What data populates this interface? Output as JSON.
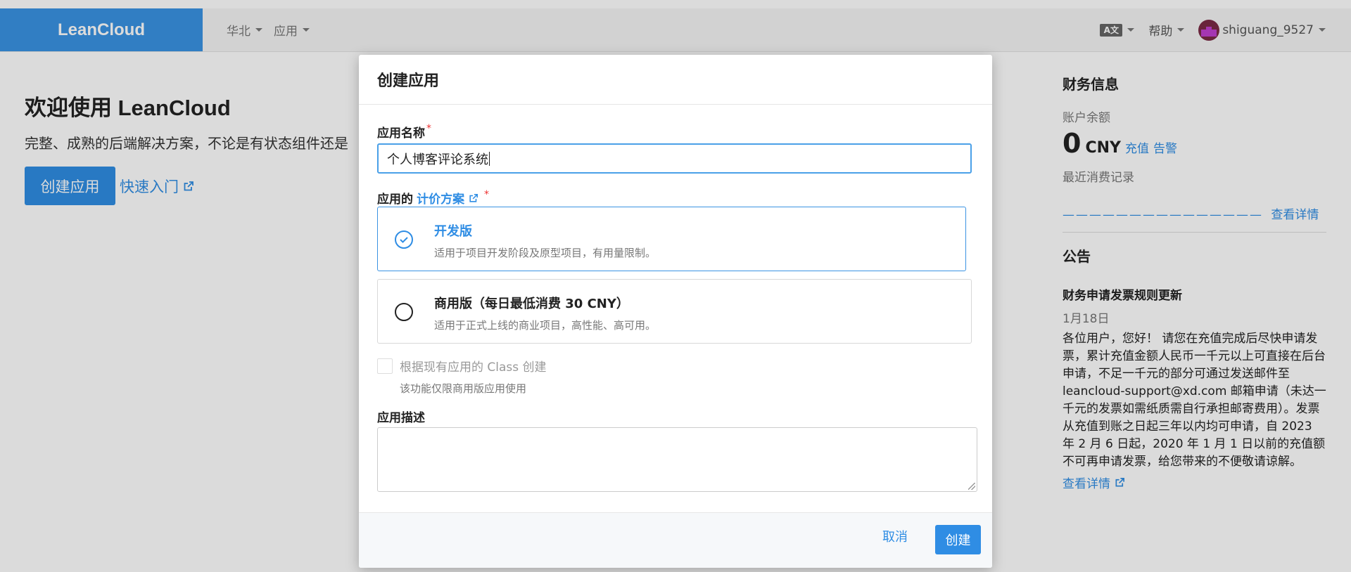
{
  "nav": {
    "brand": "LeanCloud",
    "region": "华北",
    "apps": "应用",
    "lang_icon_text": "A文",
    "help": "帮助",
    "username": "shiguang_9527"
  },
  "welcome": {
    "title": "欢迎使用 LeanCloud",
    "subtitle": "完整、成熟的后端解决方案，不论是有状态组件还是",
    "create_button": "创建应用",
    "quickstart": "快速入门"
  },
  "finance": {
    "heading": "财务信息",
    "balance_label": "账户余额",
    "balance_value": "0",
    "currency": "CNY",
    "recharge": "充值",
    "alert": "告警",
    "recent_label": "最近消费记录",
    "placeholder_dashes": "———————————————",
    "view_details": "查看详情"
  },
  "notice": {
    "heading": "公告",
    "title": "财务申请发票规则更新",
    "date": "1月18日",
    "body": "各位用户，您好！ 请您在充值完成后尽快申请发票，累计充值金额人民币一千元以上可直接在后台申请，不足一千元的部分可通过发送邮件至 leancloud-support@xd.com 邮箱申请（未达一千元的发票如需纸质需自行承担邮寄费用）。发票从充值到账之日起三年以内均可申请，自 2023 年 2 月 6 日起，2020 年 1 月 1 日以前的充值额不可再申请发票，给您带来的不便敬请谅解。",
    "view_details": "查看详情"
  },
  "modal": {
    "title": "创建应用",
    "name_label": "应用名称",
    "required_mark": "*",
    "name_value": "个人博客评论系统",
    "plan_label_prefix": "应用的",
    "plan_link": "计价方案",
    "plans": [
      {
        "title": "开发版",
        "desc": "适用于项目开发阶段及原型项目，有用量限制。",
        "selected": true
      },
      {
        "title": "商用版（每日最低消费 30 CNY）",
        "desc": "适用于正式上线的商业项目，高性能、高可用。",
        "selected": false
      }
    ],
    "class_checkbox_label": "根据现有应用的 Class 创建",
    "class_checkbox_hint": "该功能仅限商用版应用使用",
    "desc_label": "应用描述",
    "cancel": "取消",
    "submit": "创建"
  },
  "colors": {
    "accent": "#2f8de4",
    "brand_bg": "#3a93e3",
    "required": "#e33333"
  }
}
